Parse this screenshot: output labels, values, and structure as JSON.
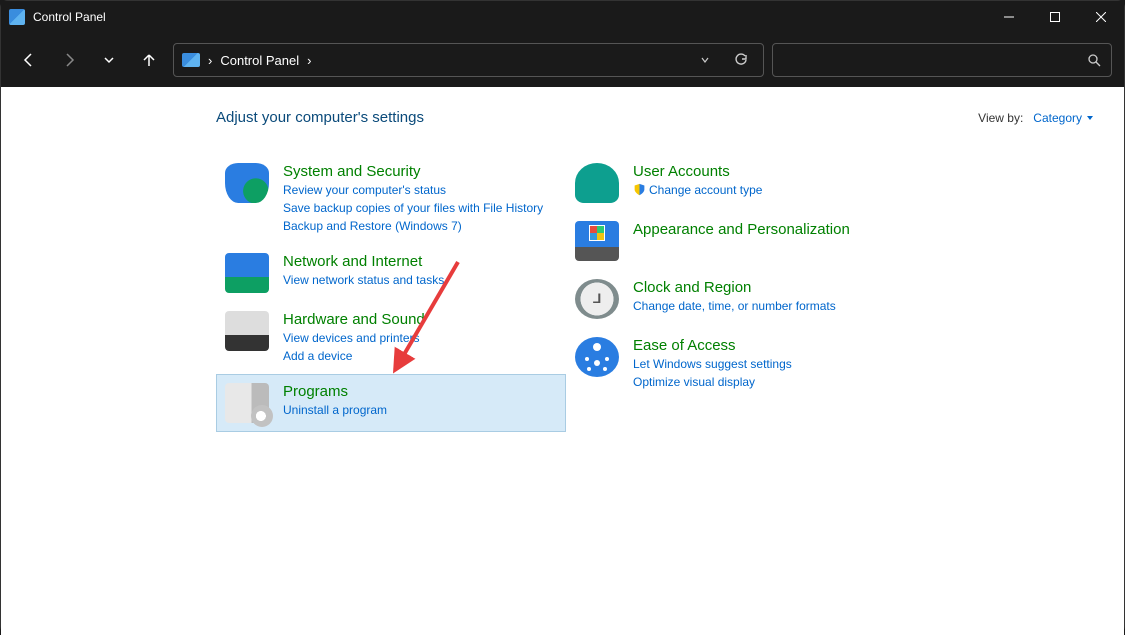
{
  "window": {
    "title": "Control Panel"
  },
  "breadcrumb": {
    "root": "Control Panel",
    "sep1": "›",
    "sep2": "›"
  },
  "heading": "Adjust your computer's settings",
  "viewby": {
    "label": "View by:",
    "value": "Category"
  },
  "left_items": [
    {
      "title": "System and Security",
      "links": [
        "Review your computer's status",
        "Save backup copies of your files with File History",
        "Backup and Restore (Windows 7)"
      ]
    },
    {
      "title": "Network and Internet",
      "links": [
        "View network status and tasks"
      ]
    },
    {
      "title": "Hardware and Sound",
      "links": [
        "View devices and printers",
        "Add a device"
      ]
    },
    {
      "title": "Programs",
      "links": [
        "Uninstall a program"
      ]
    }
  ],
  "right_items": [
    {
      "title": "User Accounts",
      "links": [
        "Change account type"
      ],
      "shield": [
        true
      ]
    },
    {
      "title": "Appearance and Personalization",
      "links": []
    },
    {
      "title": "Clock and Region",
      "links": [
        "Change date, time, or number formats"
      ]
    },
    {
      "title": "Ease of Access",
      "links": [
        "Let Windows suggest settings",
        "Optimize visual display"
      ]
    }
  ]
}
